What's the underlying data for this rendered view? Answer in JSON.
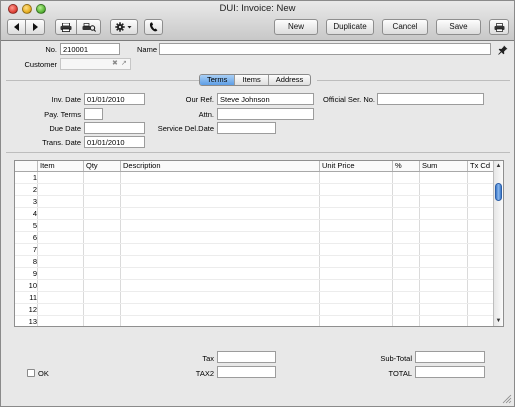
{
  "window": {
    "title": "DUI: Invoice: New"
  },
  "toolbar": {
    "new_label": "New",
    "duplicate_label": "Duplicate",
    "cancel_label": "Cancel",
    "save_label": "Save",
    "icons": [
      "back-arrow-icon",
      "forward-arrow-icon",
      "print-icon",
      "print-preview-icon",
      "gear-icon",
      "phone-icon",
      "printer-icon"
    ]
  },
  "header": {
    "no_label": "No.",
    "no_value": "210001",
    "name_label": "Name",
    "name_value": "",
    "customer_label": "Customer",
    "customer_value": ""
  },
  "tabs": [
    {
      "label": "Terms",
      "active": true
    },
    {
      "label": "Items",
      "active": false
    },
    {
      "label": "Address",
      "active": false
    }
  ],
  "terms": {
    "inv_date_label": "Inv. Date",
    "inv_date_value": "01/01/2010",
    "pay_terms_label": "Pay. Terms",
    "pay_terms_value": "",
    "due_date_label": "Due Date",
    "due_date_value": "",
    "trans_date_label": "Trans. Date",
    "trans_date_value": "01/01/2010",
    "our_ref_label": "Our Ref.",
    "our_ref_value": "Steve Johnson",
    "attn_label": "Attn.",
    "attn_value": "",
    "service_del_date_label": "Service Del.Date",
    "service_del_date_value": "",
    "official_ser_no_label": "Official Ser. No.",
    "official_ser_no_value": ""
  },
  "grid": {
    "columns": [
      "Item",
      "Qty",
      "Description",
      "Unit Price",
      "%",
      "Sum",
      "Tx Cd"
    ],
    "row_numbers": [
      "1",
      "2",
      "3",
      "4",
      "5",
      "6",
      "7",
      "8",
      "9",
      "10",
      "11",
      "12",
      "13"
    ]
  },
  "footer": {
    "ok_label": "OK",
    "ok_checked": false,
    "tax_label": "Tax",
    "tax_value": "",
    "tax2_label": "TAX2",
    "tax2_value": "",
    "subtotal_label": "Sub-Total",
    "subtotal_value": "",
    "total_label": "TOTAL",
    "total_value": ""
  }
}
